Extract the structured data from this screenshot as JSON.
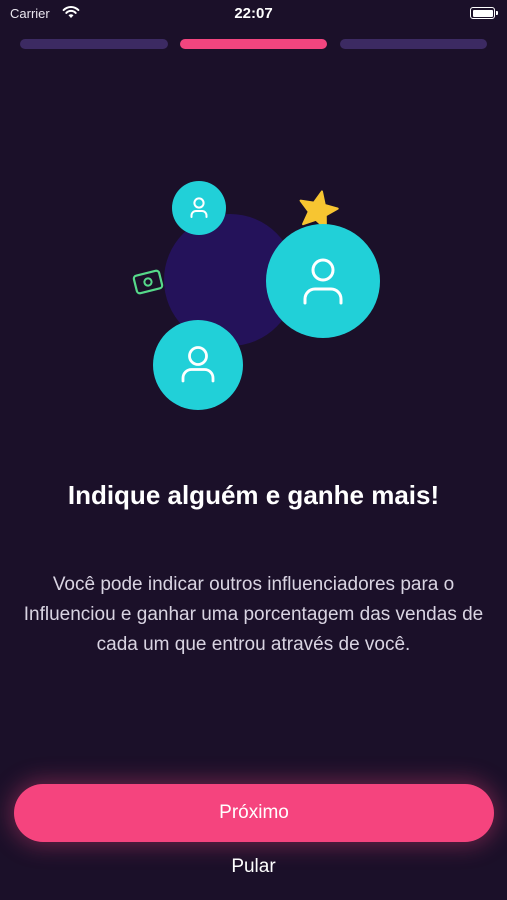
{
  "status_bar": {
    "carrier": "Carrier",
    "time": "22:07"
  },
  "progress": {
    "step_count": 3,
    "active_step": 2,
    "active_color": "#f2457f",
    "inactive_color": "#3c2a62"
  },
  "illustration": {
    "icons": [
      "user-icon",
      "user-icon",
      "user-icon",
      "star-icon",
      "money-icon"
    ],
    "accent_color": "#21d0d8",
    "star_color": "#f7c531",
    "money_color": "#56d98a"
  },
  "onboarding": {
    "title": "Indique alguém e ganhe mais!",
    "description": "Você pode indicar outros influenciadores para o Influenciou e ganhar uma porcentagem das vendas de cada um que entrou através de você.",
    "next_label": "Próximo",
    "skip_label": "Pular"
  },
  "colors": {
    "background": "#1b1029",
    "button": "#f5447e"
  }
}
